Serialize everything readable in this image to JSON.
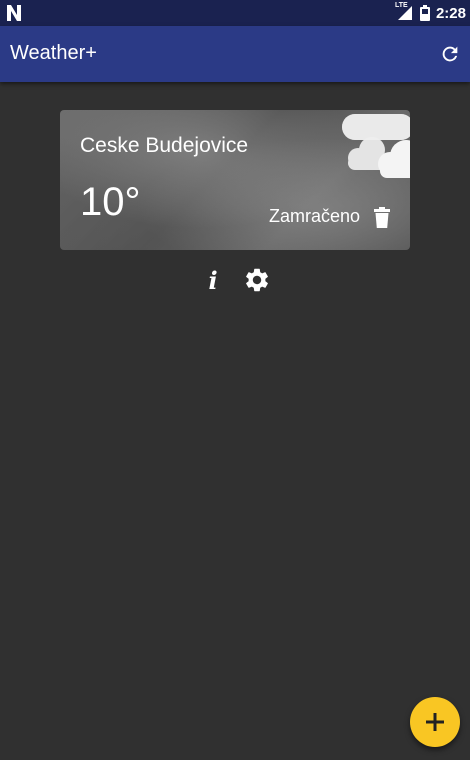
{
  "status_bar": {
    "time": "2:28",
    "network_label": "LTE",
    "icons": [
      "notification-n-icon",
      "signal-icon",
      "battery-icon"
    ]
  },
  "app_bar": {
    "title": "Weather+",
    "refresh_icon": "refresh-icon"
  },
  "cards": [
    {
      "city": "Ceske Budejovice",
      "temperature": "10°",
      "condition": "Zamračeno",
      "weather_icon": "cloudy-icon",
      "delete_icon": "delete-icon"
    }
  ],
  "actions": {
    "info_label": "i",
    "info_icon": "info-icon",
    "settings_icon": "gear-icon"
  },
  "fab": {
    "label": "+",
    "icon": "add-icon"
  },
  "colors": {
    "status_bar": "#1a2250",
    "app_bar": "#2b3a86",
    "background": "#303030",
    "fab": "#f9c623"
  }
}
